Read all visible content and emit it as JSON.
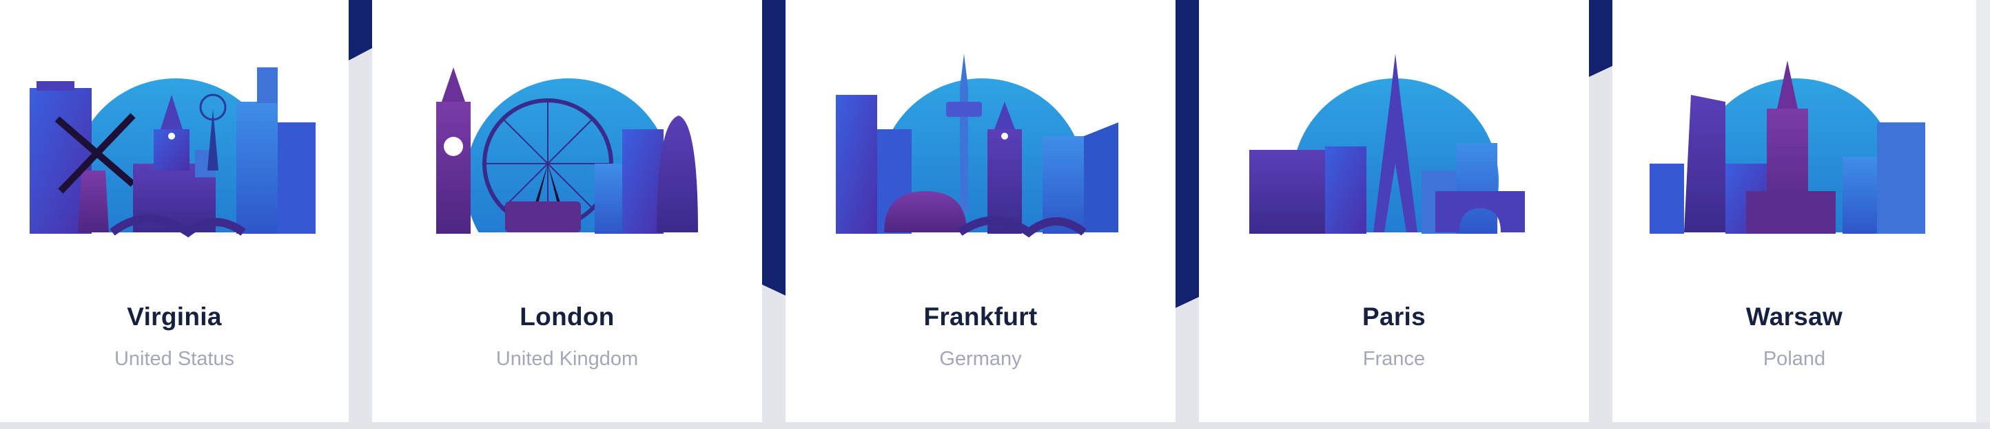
{
  "colors": {
    "card_bg": "#ffffff",
    "page_bg": "#ebecf0",
    "accent_band": "#13226f",
    "sky_top": "#2d9ce0",
    "sky_bottom": "#1f62c8",
    "city_title": "#15213f",
    "country_text": "#a3a7b8"
  },
  "locations": [
    {
      "city": "Virginia",
      "country": "United Status",
      "illustration": "virginia-skyline-illustration"
    },
    {
      "city": "London",
      "country": "United Kingdom",
      "illustration": "london-skyline-illustration"
    },
    {
      "city": "Frankfurt",
      "country": "Germany",
      "illustration": "frankfurt-skyline-illustration"
    },
    {
      "city": "Paris",
      "country": "France",
      "illustration": "paris-skyline-illustration"
    },
    {
      "city": "Warsaw",
      "country": "Poland",
      "illustration": "warsaw-skyline-illustration"
    }
  ]
}
